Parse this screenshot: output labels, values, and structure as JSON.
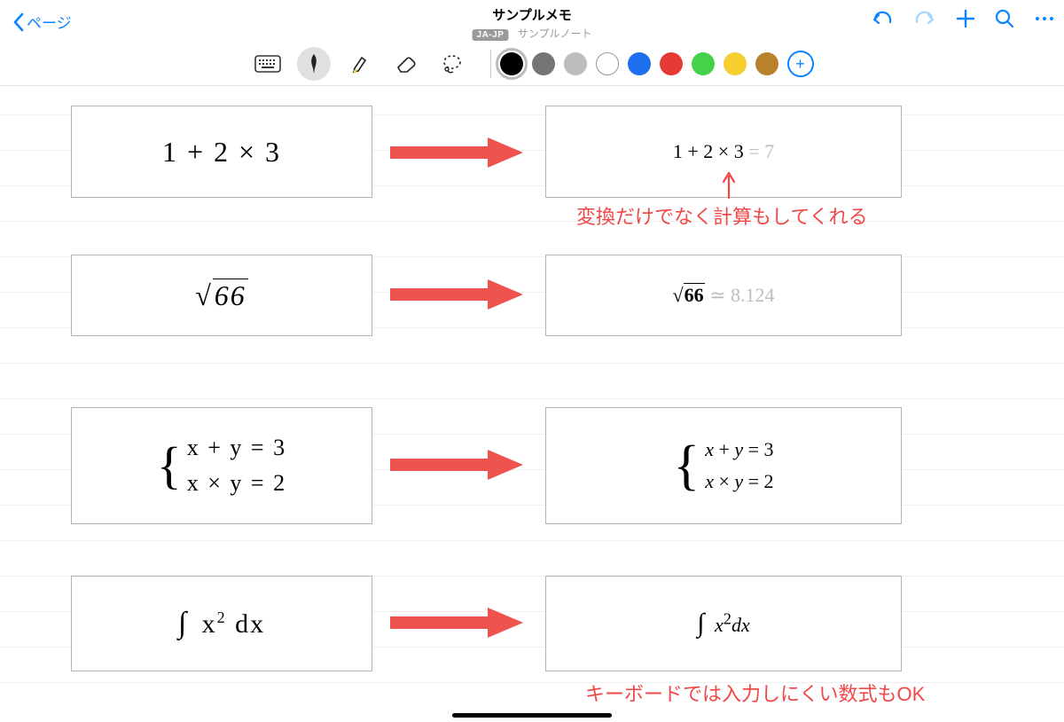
{
  "nav": {
    "back_label": "ページ",
    "title": "サンプルメモ",
    "badge": "JA-JP",
    "subtitle": "サンプルノート"
  },
  "tool_icons": {
    "keyboard": "keyboard-icon",
    "pen": "pen-icon",
    "highlighter": "highlighter-icon",
    "eraser": "eraser-icon",
    "lasso": "lasso-icon",
    "add_color": "+"
  },
  "colors": {
    "options": [
      "#000000",
      "#757575",
      "#bdbdbd",
      "hollow",
      "#1e6ef0",
      "#e53935",
      "#43d24a",
      "#f5cf2f",
      "#b8822d"
    ],
    "selected_index": 0
  },
  "rows": [
    {
      "handwritten": "1 + 2 × 3",
      "typeset_main": "1 + 2 × 3",
      "typeset_result": " = 7"
    },
    {
      "handwritten": "√66",
      "typeset_main": "√66",
      "typeset_result": " ≃ 8.124"
    },
    {
      "handwritten_line1": "x + y = 3",
      "handwritten_line2": "x × y = 2",
      "typeset_line1": "x + y = 3",
      "typeset_line2": "x × y = 2"
    },
    {
      "handwritten": "∫ x² dx",
      "typeset_main": "∫ x²dx"
    }
  ],
  "annotations": {
    "arrow_up": "↑",
    "note1": "変換だけでなく計算もしてくれる",
    "note2": "キーボードでは入力しにくい数式もOK"
  }
}
